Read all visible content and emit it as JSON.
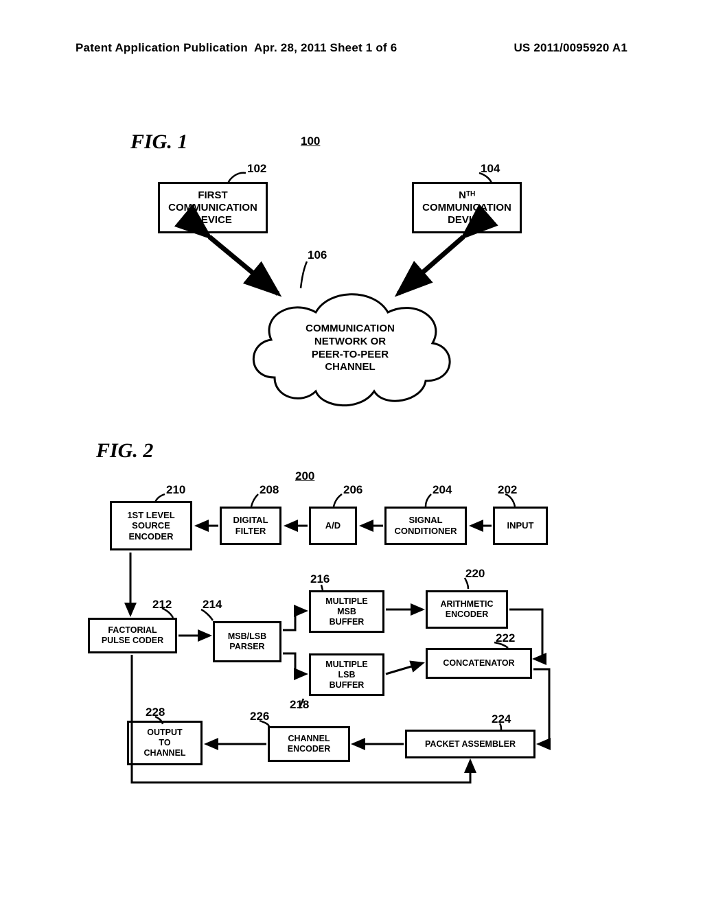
{
  "header": {
    "left": "Patent Application Publication",
    "mid": "Apr. 28, 2011  Sheet 1 of 6",
    "right": "US 2011/0095920 A1"
  },
  "fig1": {
    "label": "FIG. 1",
    "systemRef": "100",
    "block102": {
      "ref": "102",
      "text": "FIRST\nCOMMUNICATION\nDEVICE"
    },
    "block104": {
      "ref": "104",
      "text": "Nᵀᴴ\nCOMMUNICATION\nDEVICE"
    },
    "cloud": {
      "ref": "106",
      "text": "COMMUNICATION\nNETWORK OR\nPEER-TO-PEER\nCHANNEL"
    }
  },
  "fig2": {
    "label": "FIG. 2",
    "systemRef": "200",
    "b210": {
      "ref": "210",
      "text": "1ST LEVEL\nSOURCE\nENCODER"
    },
    "b208": {
      "ref": "208",
      "text": "DIGITAL\nFILTER"
    },
    "b206": {
      "ref": "206",
      "text": "A/D"
    },
    "b204": {
      "ref": "204",
      "text": "SIGNAL\nCONDITIONER"
    },
    "b202": {
      "ref": "202",
      "text": "INPUT"
    },
    "b212": {
      "ref": "212",
      "text": "FACTORIAL\nPULSE CODER"
    },
    "b214": {
      "ref": "214",
      "text": "MSB/LSB\nPARSER"
    },
    "b216": {
      "ref": "216",
      "text": "MULTIPLE\nMSB\nBUFFER"
    },
    "b218": {
      "ref": "218",
      "text": "MULTIPLE\nLSB\nBUFFER"
    },
    "b220": {
      "ref": "220",
      "text": "ARITHMETIC\nENCODER"
    },
    "b222": {
      "ref": "222",
      "text": "CONCATENATOR"
    },
    "b224": {
      "ref": "224",
      "text": "PACKET ASSEMBLER"
    },
    "b226": {
      "ref": "226",
      "text": "CHANNEL\nENCODER"
    },
    "b228": {
      "ref": "228",
      "text": "OUTPUT\nTO\nCHANNEL"
    }
  }
}
